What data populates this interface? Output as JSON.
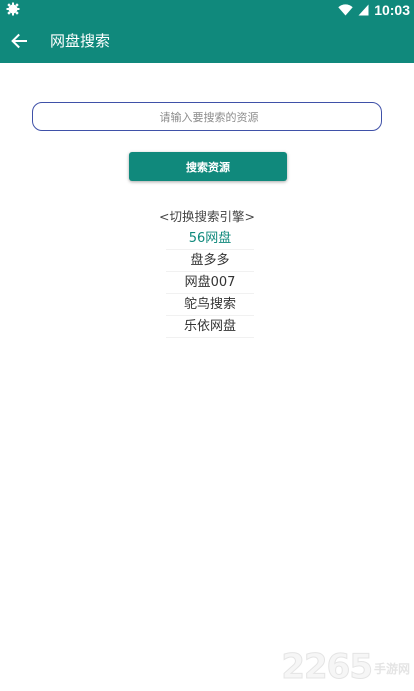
{
  "status_bar": {
    "time": "10:03"
  },
  "app_bar": {
    "title": "网盘搜索"
  },
  "search": {
    "placeholder": "请输入要搜索的资源",
    "value": ""
  },
  "actions": {
    "search_label": "搜索资源"
  },
  "engines": {
    "header": "<切换搜索引擎>",
    "items": [
      {
        "label": "56网盘",
        "selected": true
      },
      {
        "label": "盘多多",
        "selected": false
      },
      {
        "label": "网盘007",
        "selected": false
      },
      {
        "label": "鸵鸟搜索",
        "selected": false
      },
      {
        "label": "乐依网盘",
        "selected": false
      }
    ]
  },
  "watermark": {
    "number": "2265",
    "text": "手游网"
  },
  "colors": {
    "primary": "#10897c",
    "input_border": "#3f51a8"
  }
}
